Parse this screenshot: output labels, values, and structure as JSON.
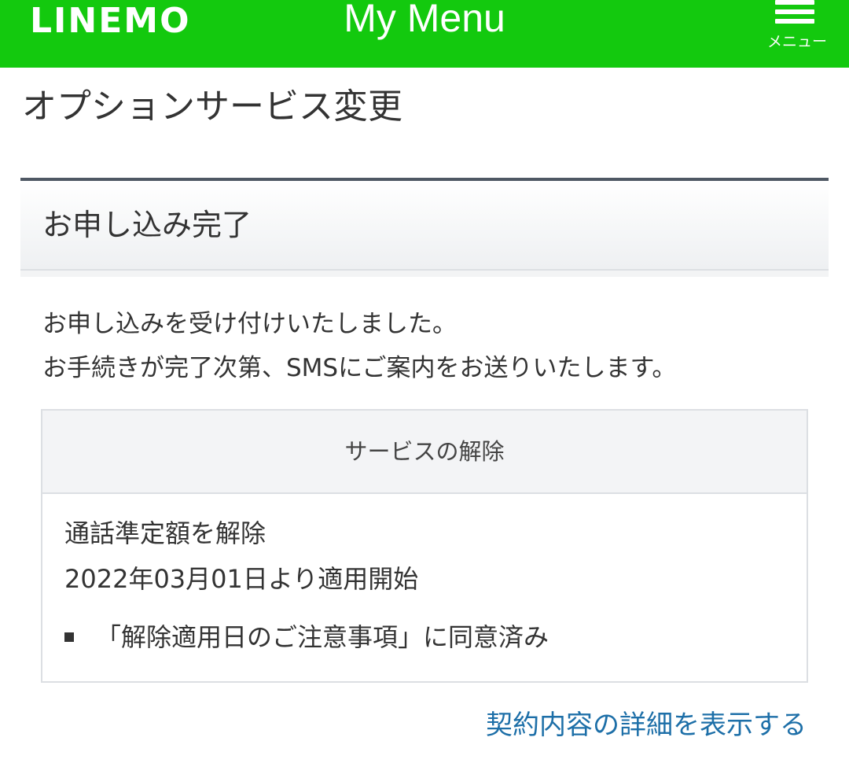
{
  "header": {
    "logo": "LINEMO",
    "title": "My Menu",
    "menu_label": "メニュー",
    "menu_icon": "hamburger-menu-icon",
    "background_color": "#13c90e"
  },
  "page": {
    "title": "オプションサービス変更"
  },
  "section": {
    "title": "お申し込み完了"
  },
  "message": {
    "line1": "お申し込みを受け付けいたしました。",
    "line2": "お手続きが完了次第、SMSにご案内をお送りいたします。"
  },
  "detail": {
    "header": "サービスの解除",
    "line1": "通話準定額を解除",
    "line2": "2022年03月01日より適用開始",
    "note": "「解除適用日のご注意事項」に同意済み"
  },
  "link": {
    "label": "契約内容の詳細を表示する",
    "color": "#1d6fa8"
  }
}
